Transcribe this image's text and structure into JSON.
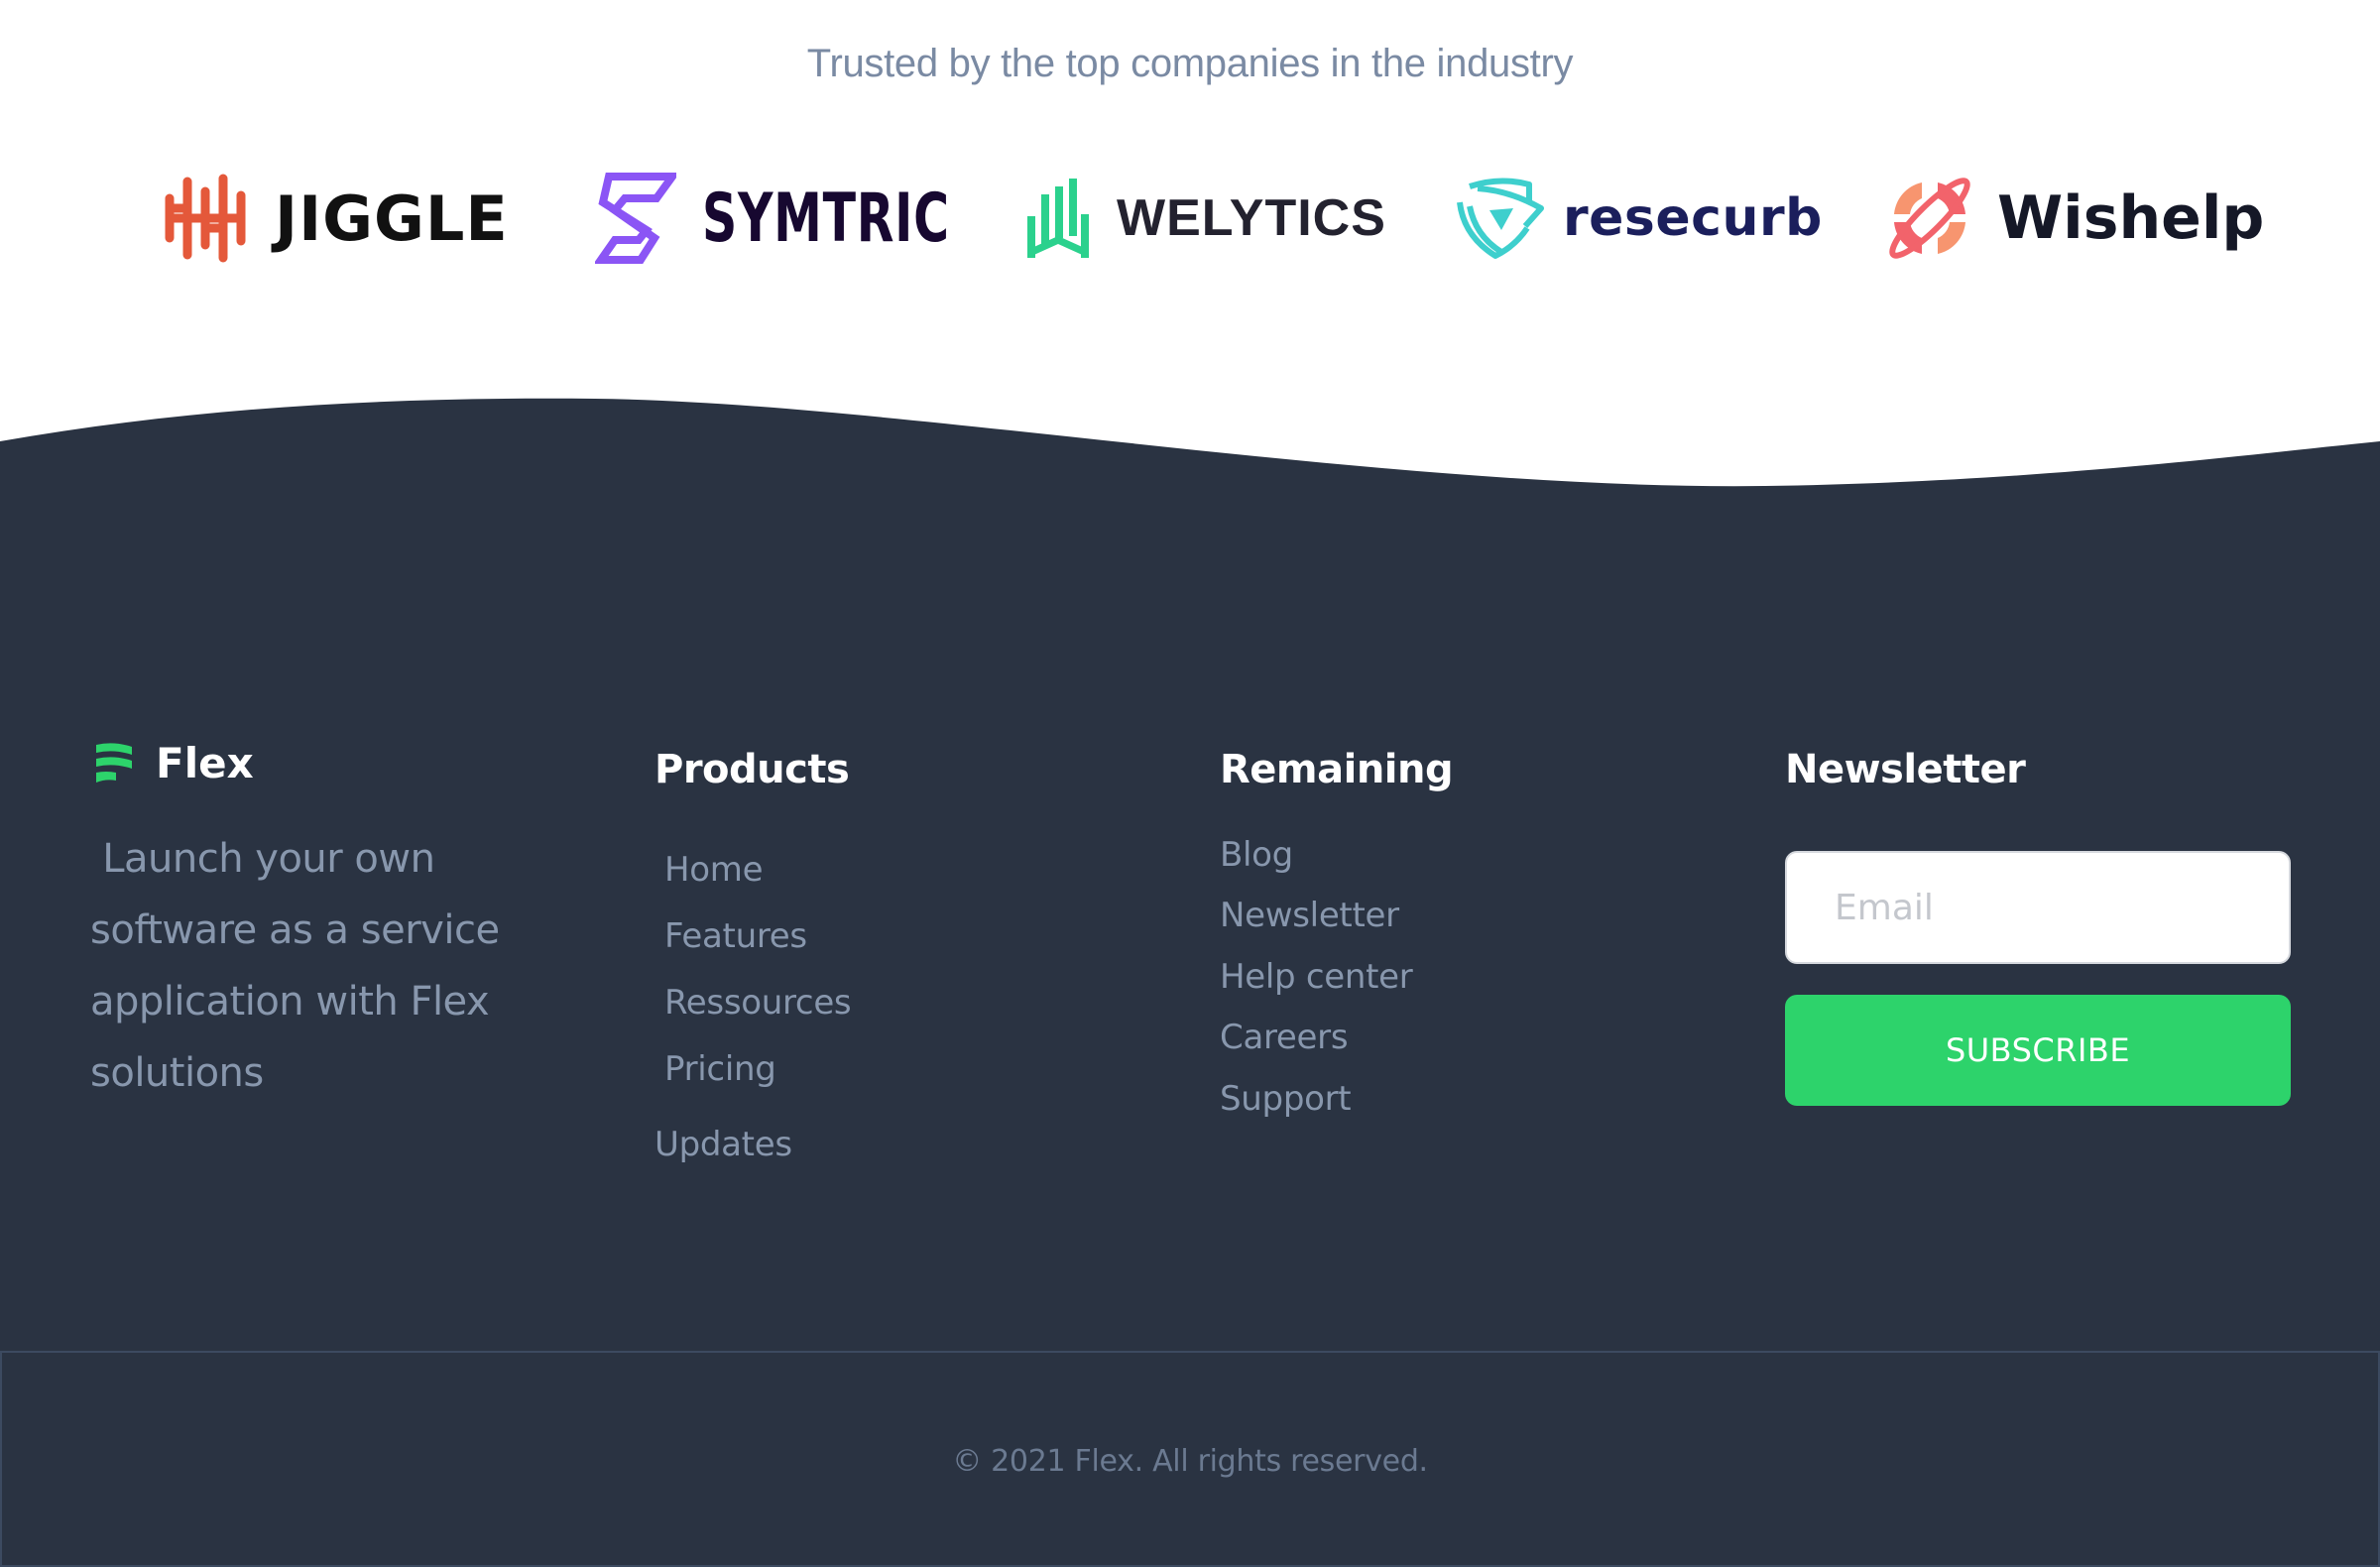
{
  "trusted": {
    "title": "Trusted by the top companies in the industry",
    "logos": [
      {
        "name": "JIGGLE",
        "icon": "jiggle-waveform-icon",
        "color": "#e4583a"
      },
      {
        "name": "SYMTRIC",
        "icon": "symtric-s-icon",
        "color": "#8b55f5"
      },
      {
        "name": "WELYTICS",
        "icon": "welytics-bars-icon",
        "color": "#2bd18d"
      },
      {
        "name": "resecurb",
        "icon": "resecurb-shield-icon",
        "color": "#3ecfcd"
      },
      {
        "name": "Wishelp",
        "icon": "wishelp-planet-icon",
        "color": "#f2636b"
      }
    ]
  },
  "footer": {
    "brand": {
      "name": "Flex",
      "icon": "flex-wave-icon",
      "accent": "#2dd36b",
      "tagline": " Launch your own software as a service application with Flex solutions"
    },
    "products": {
      "heading": "Products",
      "links": [
        "Home",
        "Features",
        "Ressources",
        "Pricing",
        "Updates"
      ]
    },
    "remaining": {
      "heading": "Remaining",
      "links": [
        "Blog",
        "Newsletter",
        "Help center",
        "Careers",
        "Support"
      ]
    },
    "newsletter": {
      "heading": "Newsletter",
      "email_placeholder": "Email",
      "email_value": "",
      "subscribe_label": "SUBSCRIBE",
      "button_color": "#2dd36b"
    },
    "copyright": "© 2021 Flex. All rights reserved.",
    "background": "#2a3342"
  }
}
